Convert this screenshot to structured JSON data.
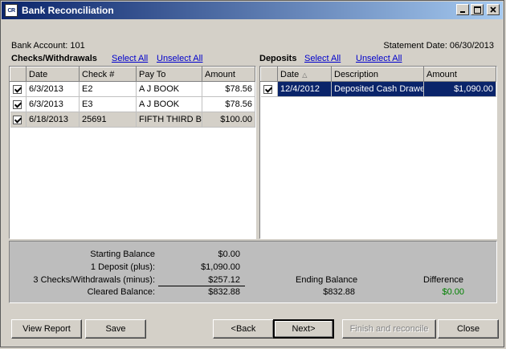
{
  "window": {
    "title": "Bank Reconciliation",
    "icon_text": "CR"
  },
  "header": {
    "bank_account": "Bank Account: 101",
    "statement_date": "Statement Date: 06/30/2013"
  },
  "checks": {
    "title": "Checks/Withdrawals",
    "select_all": "Select All",
    "unselect_all": "Unselect All",
    "columns": {
      "date": "Date",
      "check": "Check #",
      "payto": "Pay To",
      "amount": "Amount"
    },
    "rows": [
      {
        "date": "6/3/2013",
        "check": "E2",
        "payto": "A J BOOK",
        "amount": "$78.56"
      },
      {
        "date": "6/3/2013",
        "check": "E3",
        "payto": "A J BOOK",
        "amount": "$78.56"
      },
      {
        "date": "6/18/2013",
        "check": "25691",
        "payto": "FIFTH THIRD B",
        "amount": "$100.00"
      }
    ]
  },
  "deposits": {
    "title": "Deposits",
    "select_all": "Select All",
    "unselect_all": "Unselect All",
    "columns": {
      "date": "Date",
      "description": "Description",
      "amount": "Amount"
    },
    "rows": [
      {
        "date": "12/4/2012",
        "description": "Deposited Cash Drawe",
        "amount": "$1,090.00"
      }
    ]
  },
  "summary": {
    "starting_balance_label": "Starting Balance",
    "starting_balance": "$0.00",
    "deposit_label": "1 Deposit (plus):",
    "deposit_value": "$1,090.00",
    "checks_label": "3 Checks/Withdrawals (minus):",
    "checks_value": "$257.12",
    "cleared_label": "Cleared Balance:",
    "cleared_value": "$832.88",
    "ending_label": "Ending Balance",
    "ending_value": "$832.88",
    "difference_label": "Difference",
    "difference_value": "$0.00",
    "difference_color": "#008000"
  },
  "buttons": {
    "view_report": "View Report",
    "save": "Save",
    "back": "<Back",
    "next": "Next>",
    "finish": "Finish and reconcile",
    "close": "Close"
  }
}
